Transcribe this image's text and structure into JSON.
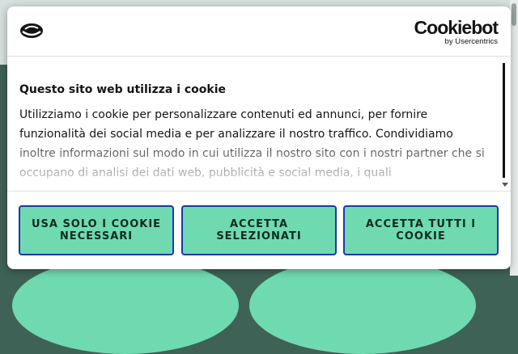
{
  "dialog": {
    "brand": {
      "name": "Cookiebot",
      "sub": "by Usercentrics"
    },
    "title": "Questo sito web utilizza i cookie",
    "body": "Utilizziamo i cookie per personalizzare contenuti ed annunci, per fornire funzionalità dei social media e per analizzare il nostro traffico. Condividiamo inoltre informazioni sul modo in cui utilizza il nostro sito con i nostri partner che si occupano di analisi dei dati web, pubblicità e social media, i quali",
    "buttons": {
      "necessary": "Usa solo i cookie necessari",
      "selected": "Accetta selezionati",
      "all": "Accetta tutti i cookie"
    }
  },
  "colors": {
    "button_fill": "#6fdab0",
    "button_border": "#1f35b0",
    "page_background": "#3f6256"
  },
  "icons": {
    "site_logo": "helmet-icon",
    "scroll_down": "chevron-down-icon"
  }
}
